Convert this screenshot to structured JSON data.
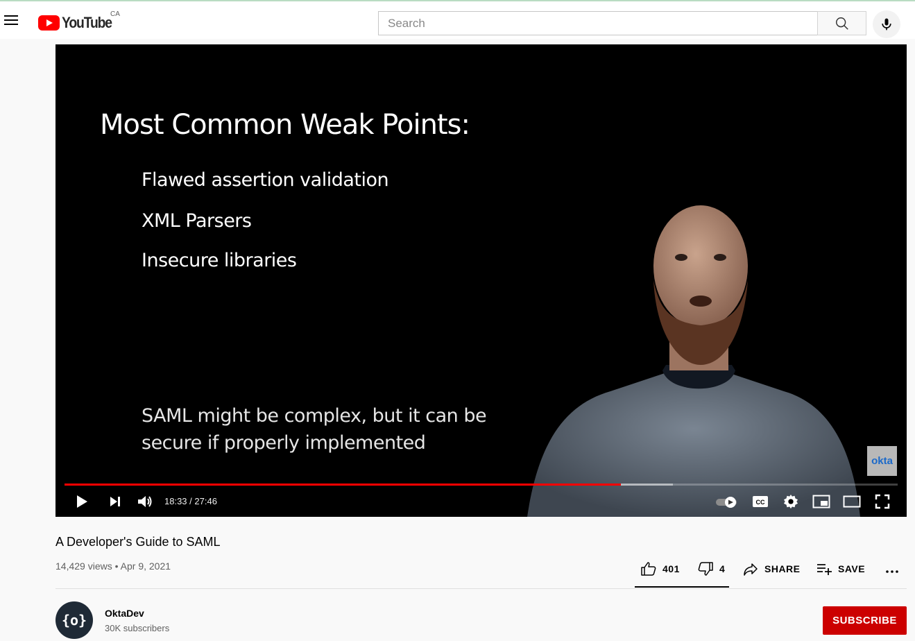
{
  "masthead": {
    "logo_text": "YouTube",
    "country_code": "CA",
    "search_placeholder": "Search"
  },
  "player": {
    "slide": {
      "title": "Most Common Weak Points:",
      "items": [
        "Flawed assertion validation",
        "XML Parsers",
        "Insecure libraries"
      ],
      "footer_line1": "SAML might be complex, but it can be",
      "footer_line2": "secure if properly implemented"
    },
    "watermark": "okta",
    "current_time": "18:33",
    "duration": "27:46",
    "progress_fraction": 0.668,
    "accent_color": "#ff0000"
  },
  "video": {
    "title": "A Developer's Guide to SAML",
    "views": "14,429 views",
    "date": "Apr 9, 2021",
    "likes": "401",
    "dislikes": "4",
    "share_label": "SHARE",
    "save_label": "SAVE",
    "more_label": "..."
  },
  "channel": {
    "avatar_text": "{o}",
    "name": "OktaDev",
    "subscribers": "30K subscribers",
    "subscribe_label": "SUBSCRIBE",
    "subscribe_color": "#cc0000"
  },
  "icons": [
    "menu-icon",
    "youtube-logo-icon",
    "search-icon",
    "microphone-icon",
    "play-icon",
    "next-icon",
    "volume-icon",
    "autoplay-toggle-icon",
    "captions-icon",
    "settings-icon",
    "miniplayer-icon",
    "theater-mode-icon",
    "fullscreen-icon",
    "thumbs-up-icon",
    "thumbs-down-icon",
    "share-icon",
    "playlist-add-icon",
    "more-actions-icon"
  ]
}
